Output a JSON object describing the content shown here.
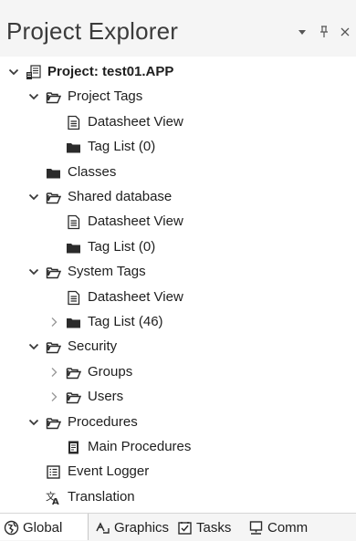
{
  "header": {
    "title": "Project Explorer",
    "dropdown_glyph": "▾",
    "pin_glyph": "ѱ",
    "close_glyph": "×"
  },
  "tree": [
    {
      "label": "Project: test01.APP",
      "depth": 0,
      "chevron": "expanded",
      "icon": "project-icon",
      "bold": true
    },
    {
      "label": "Project Tags",
      "depth": 1,
      "chevron": "expanded",
      "icon": "folder-open-icon"
    },
    {
      "label": "Datasheet View",
      "depth": 2,
      "chevron": "none",
      "icon": "document-icon"
    },
    {
      "label": "Tag List (0)",
      "depth": 2,
      "chevron": "none",
      "icon": "folder-closed-icon"
    },
    {
      "label": "Classes",
      "depth": 1,
      "chevron": "none",
      "icon": "folder-closed-icon"
    },
    {
      "label": "Shared database",
      "depth": 1,
      "chevron": "expanded",
      "icon": "folder-open-icon"
    },
    {
      "label": "Datasheet View",
      "depth": 2,
      "chevron": "none",
      "icon": "document-icon"
    },
    {
      "label": "Tag List (0)",
      "depth": 2,
      "chevron": "none",
      "icon": "folder-closed-icon"
    },
    {
      "label": "System Tags",
      "depth": 1,
      "chevron": "expanded",
      "icon": "folder-open-icon"
    },
    {
      "label": "Datasheet View",
      "depth": 2,
      "chevron": "none",
      "icon": "document-icon"
    },
    {
      "label": "Tag List (46)",
      "depth": 2,
      "chevron": "collapsed",
      "icon": "folder-closed-icon"
    },
    {
      "label": "Security",
      "depth": 1,
      "chevron": "expanded",
      "icon": "folder-open-icon"
    },
    {
      "label": "Groups",
      "depth": 2,
      "chevron": "collapsed",
      "icon": "folder-open-icon"
    },
    {
      "label": "Users",
      "depth": 2,
      "chevron": "collapsed",
      "icon": "folder-open-icon"
    },
    {
      "label": "Procedures",
      "depth": 1,
      "chevron": "expanded",
      "icon": "folder-open-icon"
    },
    {
      "label": "Main Procedures",
      "depth": 2,
      "chevron": "none",
      "icon": "script-icon"
    },
    {
      "label": "Event Logger",
      "depth": 1,
      "chevron": "none",
      "icon": "log-icon"
    },
    {
      "label": "Translation",
      "depth": 1,
      "chevron": "none",
      "icon": "translate-icon"
    }
  ],
  "tabs": [
    {
      "label": "Global",
      "icon": "globe-icon",
      "active": true
    },
    {
      "label": "Graphics",
      "icon": "graphics-icon",
      "active": false
    },
    {
      "label": "Tasks",
      "icon": "tasks-icon",
      "active": false
    },
    {
      "label": "Comm",
      "icon": "comm-icon",
      "active": false
    }
  ]
}
